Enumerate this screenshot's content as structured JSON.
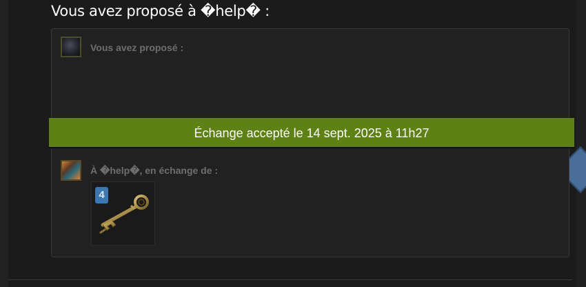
{
  "offer": {
    "heading": "Vous avez proposé à �help� :",
    "my_side_label": "Vous avez proposé :",
    "their_side_label": "À �help�, en échange de :",
    "status_banner": "Échange accepté le 14 sept. 2025 à 11h27",
    "items": [
      {
        "icon": "key-icon",
        "quantity": "4"
      }
    ]
  },
  "colors": {
    "banner": "#5d8112",
    "quantity_badge": "#3a77b5",
    "panel": "#212121"
  }
}
